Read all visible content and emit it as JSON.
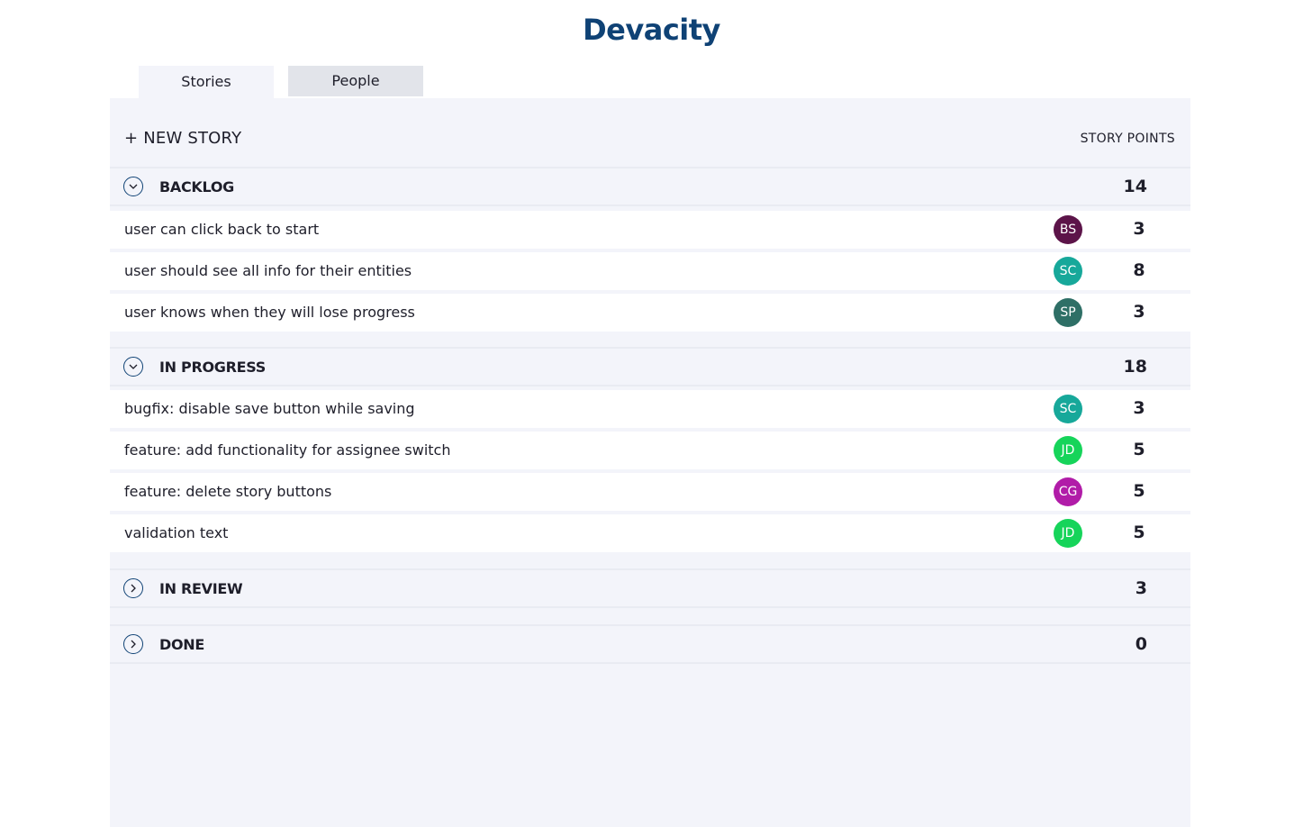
{
  "app": {
    "title": "Devacity"
  },
  "tabs": [
    {
      "label": "Stories",
      "active": true
    },
    {
      "label": "People",
      "active": false
    }
  ],
  "toolbar": {
    "new_story_label": "+ NEW STORY",
    "points_header": "STORY POINTS"
  },
  "colors": {
    "brand": "#0f4275",
    "panel_bg": "#f3f4fa",
    "avatar_BS": "#5c1449",
    "avatar_SC": "#17a89a",
    "avatar_SP": "#2e6f66",
    "avatar_JD": "#16d45a",
    "avatar_CG": "#b11ca8"
  },
  "sections": [
    {
      "title": "BACKLOG",
      "total": "14",
      "expanded": true,
      "icon": "chevron-down-icon",
      "stories": [
        {
          "title": "user can click back to start",
          "assignee": "BS",
          "points": "3",
          "color": "#5c1449"
        },
        {
          "title": "user should see all info for their entities",
          "assignee": "SC",
          "points": "8",
          "color": "#17a89a"
        },
        {
          "title": "user knows when they will lose progress",
          "assignee": "SP",
          "points": "3",
          "color": "#2e6f66"
        }
      ]
    },
    {
      "title": "IN PROGRESS",
      "total": "18",
      "expanded": true,
      "icon": "chevron-down-icon",
      "stories": [
        {
          "title": "bugfix: disable save button while saving",
          "assignee": "SC",
          "points": "3",
          "color": "#17a89a"
        },
        {
          "title": "feature: add functionality for assignee switch",
          "assignee": "JD",
          "points": "5",
          "color": "#16d45a"
        },
        {
          "title": "feature: delete story buttons",
          "assignee": "CG",
          "points": "5",
          "color": "#b11ca8"
        },
        {
          "title": "validation text",
          "assignee": "JD",
          "points": "5",
          "color": "#16d45a"
        }
      ]
    },
    {
      "title": "IN REVIEW",
      "total": "3",
      "expanded": false,
      "icon": "chevron-right-icon",
      "stories": []
    },
    {
      "title": "DONE",
      "total": "0",
      "expanded": false,
      "icon": "chevron-right-icon",
      "stories": []
    }
  ]
}
